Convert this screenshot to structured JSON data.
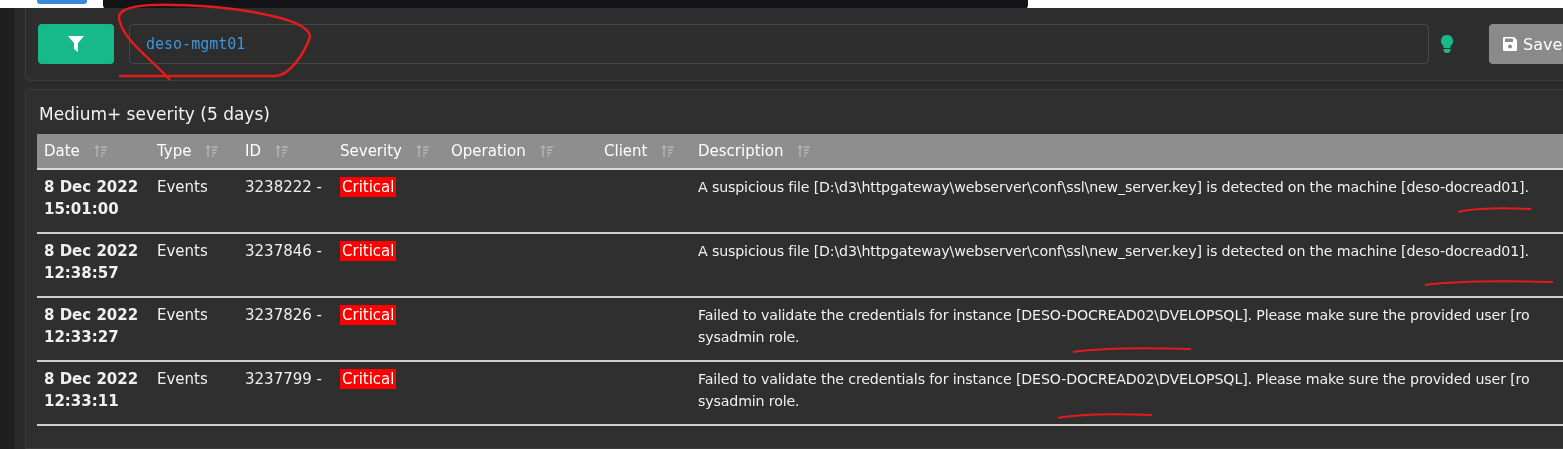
{
  "filter": {
    "value": "deso-mgmt01"
  },
  "save_button": {
    "label": "Save"
  },
  "panel": {
    "title": "Medium+ severity (5 days)"
  },
  "table": {
    "columns": [
      "Date",
      "Type",
      "ID",
      "Severity",
      "Operation",
      "Client",
      "Description"
    ],
    "rows": [
      {
        "date": "8 Dec 2022",
        "time": "15:01:00",
        "type": "Events",
        "id": "3238222 -",
        "severity": "Critical",
        "description": "A suspicious file [D:\\d3\\httpgateway\\webserver\\conf\\ssl\\new_server.key] is detected on the machine [deso-docread01]."
      },
      {
        "date": "8 Dec 2022",
        "time": "12:38:57",
        "type": "Events",
        "id": "3237846 -",
        "severity": "Critical",
        "description": "A suspicious file [D:\\d3\\httpgateway\\webserver\\conf\\ssl\\new_server.key] is detected on the machine [deso-docread01]."
      },
      {
        "date": "8 Dec 2022",
        "time": "12:33:27",
        "type": "Events",
        "id": "3237826 -",
        "severity": "Critical",
        "description": "Failed to validate the credentials for instance [DESO-DOCREAD02\\DVELOPSQL]. Please make sure the provided user [ro\nsysadmin role."
      },
      {
        "date": "8 Dec 2022",
        "time": "12:33:11",
        "type": "Events",
        "id": "3237799 -",
        "severity": "Critical",
        "description": "Failed to validate the credentials for instance [DESO-DOCREAD02\\DVELOPSQL]. Please make sure the provided user [ro\nsysadmin role."
      }
    ]
  }
}
